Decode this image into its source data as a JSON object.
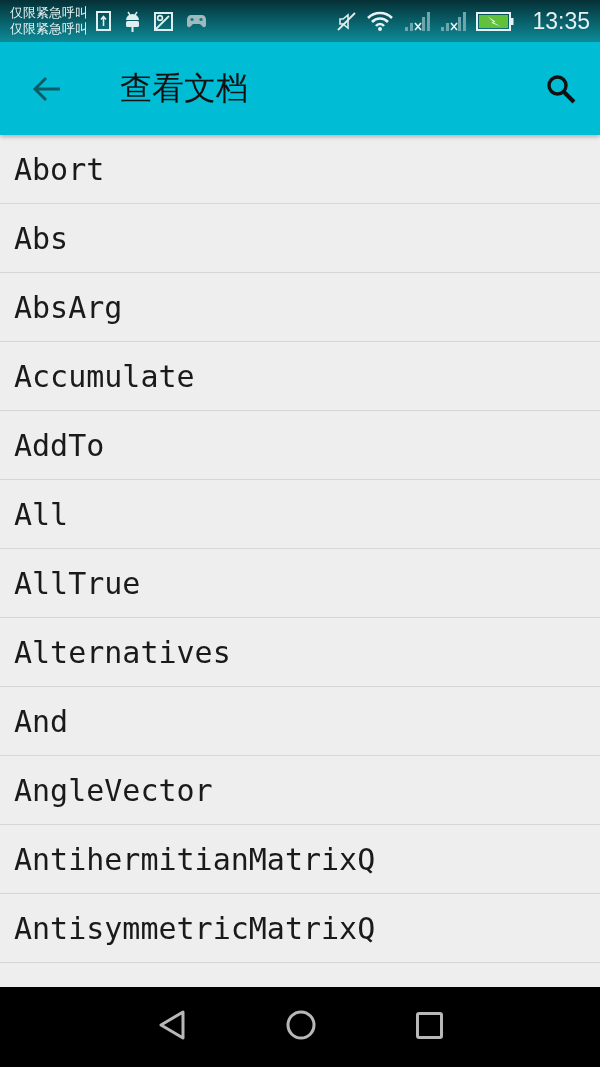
{
  "status_bar": {
    "carrier_lines": [
      "仅限紧急呼叫",
      "仅限紧急呼叫"
    ],
    "time": "13:35"
  },
  "app_bar": {
    "title": "查看文档"
  },
  "items": [
    "Abort",
    "Abs",
    "AbsArg",
    "Accumulate",
    "AddTo",
    "All",
    "AllTrue",
    "Alternatives",
    "And",
    "AngleVector",
    "AntihermitianMatrixQ",
    "AntisymmetricMatrixQ"
  ]
}
